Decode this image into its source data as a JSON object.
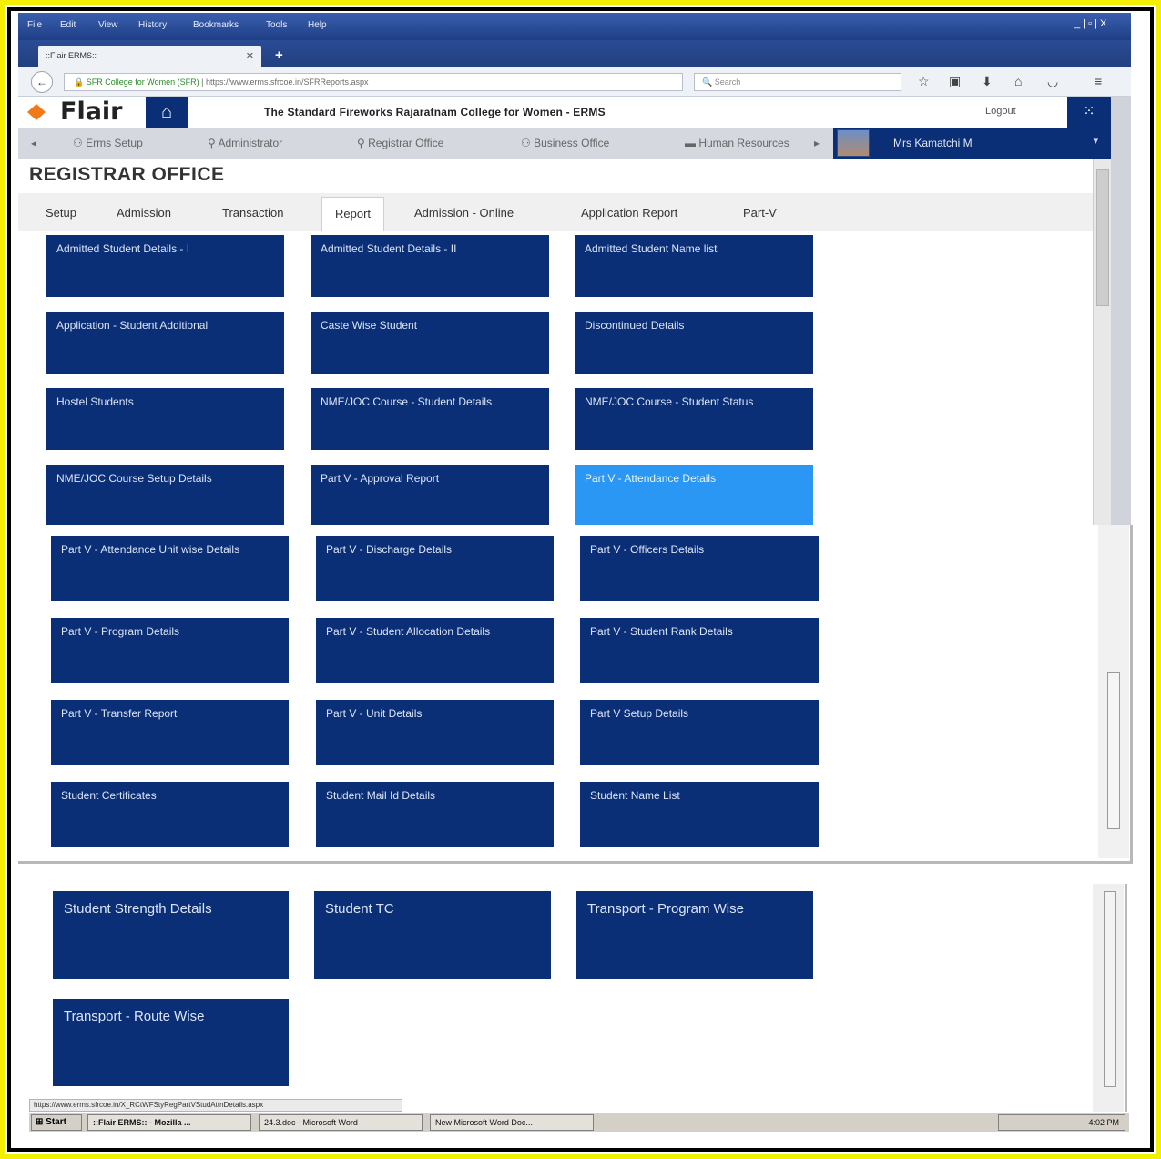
{
  "browser": {
    "menu": [
      "File",
      "Edit",
      "View",
      "History",
      "Bookmarks",
      "Tools",
      "Help"
    ],
    "tab_title": "::Flair ERMS::",
    "url_site": "SFR College for Women (SFR)",
    "url": "https://www.erms.sfrcoe.in/SFRReports.aspx",
    "search_placeholder": "Search",
    "window_controls": "_ | ▫ | X"
  },
  "app": {
    "logo": "Flair",
    "college_name": "The Standard Fireworks Rajaratnam College for Women - ERMS",
    "logout": "Logout",
    "modules": [
      "Erms Setup",
      "Administrator",
      "Registrar Office",
      "Business Office",
      "Human Resources"
    ],
    "user_name": "Mrs Kamatchi M"
  },
  "page": {
    "title": "REGISTRAR OFFICE",
    "subtabs": [
      "Setup",
      "Admission",
      "Transaction",
      "Report",
      "Admission - Online",
      "Application Report",
      "Part-V"
    ],
    "active_subtab": "Report"
  },
  "tiles_section1": [
    "Admitted Student Details - I",
    "Admitted Student Details - II",
    "Admitted Student Name list",
    "Application - Student Additional",
    "Caste Wise Student",
    "Discontinued Details",
    "Hostel Students",
    "NME/JOC Course - Student Details",
    "NME/JOC Course - Student Status",
    "NME/JOC Course Setup Details",
    "Part V - Approval Report",
    "Part V - Attendance Details"
  ],
  "tiles_section2": [
    "Part V - Attendance Unit wise Details",
    "Part V - Discharge Details",
    "Part V - Officers Details",
    "Part V - Program Details",
    "Part V - Student Allocation Details",
    "Part V - Student Rank Details",
    "Part V - Transfer Report",
    "Part V - Unit Details",
    "Part V Setup Details",
    "Student Certificates",
    "Student Mail Id Details",
    "Student Name List"
  ],
  "tiles_section3": [
    "Student Strength Details",
    "Student TC",
    "Transport - Program Wise",
    "Transport - Route Wise"
  ],
  "statusbar": {
    "link": "https://www.erms.sfrcoe.in/X_RCtWFStyRegPartVStudAttnDetails.aspx"
  },
  "taskbar": {
    "start": "Start",
    "items": [
      "::Flair ERMS:: - Mozilla ...",
      "24.3.doc - Microsoft Word",
      "New Microsoft Word Doc..."
    ],
    "clock": "4:02 PM"
  },
  "colors": {
    "tile": "#0b2f76",
    "tile_highlight": "#2a97f5",
    "frame_border": "#f2ef00"
  }
}
